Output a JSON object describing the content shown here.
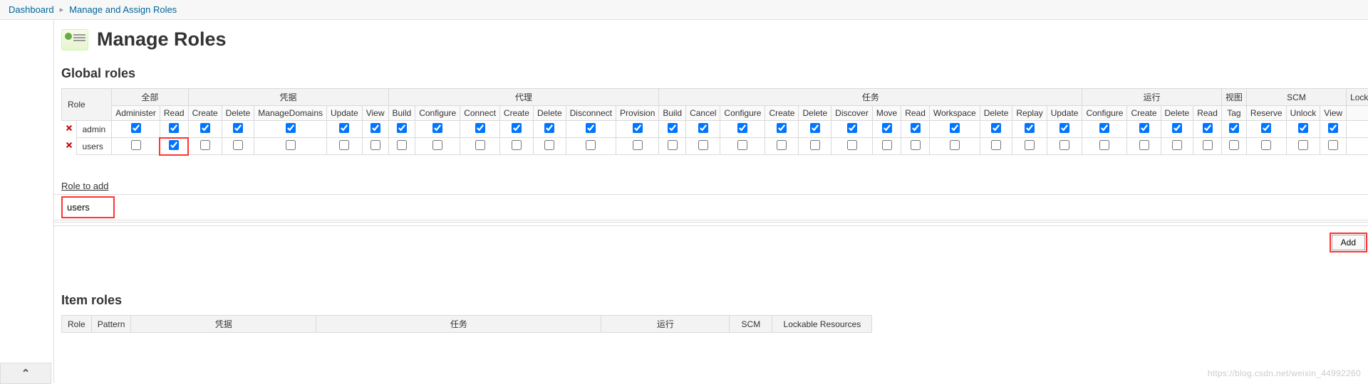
{
  "breadcrumbs": {
    "home": "Dashboard",
    "current": "Manage and Assign Roles"
  },
  "page": {
    "title": "Manage Roles"
  },
  "global_roles": {
    "heading": "Global roles",
    "role_header": "Role",
    "groups": [
      {
        "label": "全部",
        "perms": [
          "Administer",
          "Read"
        ]
      },
      {
        "label": "凭据",
        "perms": [
          "Create",
          "Delete",
          "ManageDomains",
          "Update",
          "View"
        ]
      },
      {
        "label": "代理",
        "perms": [
          "Build",
          "Configure",
          "Connect",
          "Create",
          "Delete",
          "Disconnect",
          "Provision"
        ]
      },
      {
        "label": "任务",
        "perms": [
          "Build",
          "Cancel",
          "Configure",
          "Create",
          "Delete",
          "Discover",
          "Move",
          "Read",
          "Workspace",
          "Delete",
          "Replay",
          "Update"
        ]
      },
      {
        "label": "运行",
        "perms": [
          "Configure",
          "Create",
          "Delete",
          "Read"
        ]
      },
      {
        "label": "视图",
        "perms": [
          "Tag"
        ]
      },
      {
        "label": "SCM",
        "perms": [
          "Reserve",
          "Unlock",
          "View"
        ]
      },
      {
        "label": "Lockable Resources",
        "perms": []
      }
    ],
    "rows": [
      {
        "name": "admin",
        "checks": [
          true,
          true,
          true,
          true,
          true,
          true,
          true,
          true,
          true,
          true,
          true,
          true,
          true,
          true,
          true,
          true,
          true,
          true,
          true,
          true,
          true,
          true,
          true,
          true,
          true,
          true,
          true,
          true,
          true,
          true,
          true,
          true,
          true,
          true
        ],
        "highlight_indexes": []
      },
      {
        "name": "users",
        "checks": [
          false,
          true,
          false,
          false,
          false,
          false,
          false,
          false,
          false,
          false,
          false,
          false,
          false,
          false,
          false,
          false,
          false,
          false,
          false,
          false,
          false,
          false,
          false,
          false,
          false,
          false,
          false,
          false,
          false,
          false,
          false,
          false,
          false,
          false
        ],
        "highlight_indexes": [
          1
        ]
      }
    ]
  },
  "role_to_add": {
    "label": "Role to add",
    "value": "users",
    "add_label": "Add"
  },
  "item_roles": {
    "heading": "Item roles",
    "role_header": "Role",
    "pattern_header": "Pattern",
    "groups": [
      "凭据",
      "任务",
      "运行",
      "SCM",
      "Lockable Resources"
    ]
  },
  "watermark": "https://blog.csdn.net/weixin_44992260"
}
